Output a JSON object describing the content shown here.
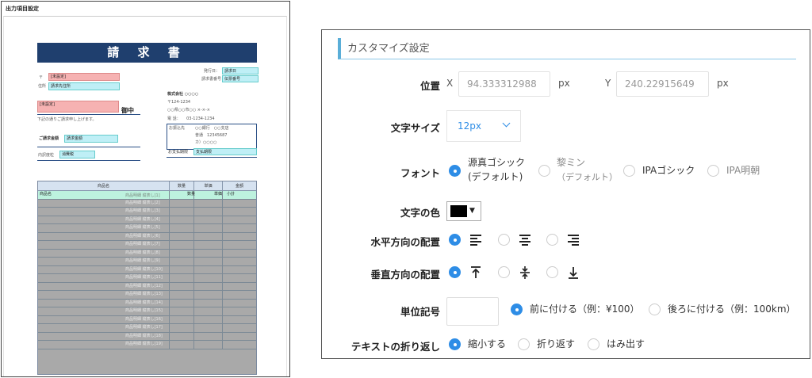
{
  "left_panel": {
    "title": "出力項目設定",
    "invoice_title": "請 求 書",
    "postal_mark": "〒",
    "postal_field": "[未設定]",
    "address_label": "住所",
    "address_field": "請求先住所",
    "recipient_field": "[未設定]",
    "honorific": "御中",
    "greeting": "下記の通りご請求申し上げます。",
    "amount_label": "ご請求金額",
    "amount_field": "請求金額",
    "content_label": "内訳度粒",
    "content_field": "消費税",
    "issue_date_label": "発行日：",
    "issue_date_field": "請求日",
    "invoice_no_label": "請求書番号：",
    "invoice_no_field": "伝票番号",
    "company_name": "株式会社 ○○○○",
    "company_zip": "〒124-1234",
    "company_addr": "○○県○○市○○ ×-×-×",
    "company_tel": "電 話：　　03-1234-1234",
    "bank_label": "お振込先",
    "bank_line1": "○○銀行　○○支店",
    "bank_line2": "普通　12345687",
    "bank_line3": "カ）○○○○",
    "due_label": "お支払期限",
    "due_field": "支払期限",
    "table_headers": [
      "商品名",
      "数量",
      "単価",
      "金額"
    ],
    "first_row": {
      "name_field": "商品名",
      "desc": "商品明細 縦表し[1]",
      "qty": "数量",
      "price": "単価",
      "sub": "小計"
    },
    "rows": [
      "商品明細 縦表し[2]",
      "商品明細 縦表し[3]",
      "商品明細 縦表し[4]",
      "商品明細 縦表し[5]",
      "商品明細 縦表し[6]",
      "商品明細 縦表し[7]",
      "商品明細 縦表し[8]",
      "商品明細 縦表し[9]",
      "商品明細 縦表し[10]",
      "商品明細 縦表し[11]",
      "商品明細 縦表し[12]",
      "商品明細 縦表し[13]",
      "商品明細 縦表し[14]",
      "商品明細 縦表し[15]",
      "商品明細 縦表し[16]",
      "商品明細 縦表し[17]",
      "商品明細 縦表し[18]",
      "商品明細 縦表し[19]"
    ]
  },
  "settings": {
    "header": "カスタマイズ設定",
    "position": {
      "label": "位置",
      "x_label": "X",
      "x_value": "94.333312988",
      "x_unit": "px",
      "y_label": "Y",
      "y_value": "240.22915649",
      "y_unit": "px"
    },
    "font_size": {
      "label": "文字サイズ",
      "value": "12px"
    },
    "font": {
      "label": "フォント",
      "options": [
        "源真ゴシック",
        "(デフォルト)",
        "黎ミン",
        "（デフォルト）",
        "IPAゴシック",
        "IPA明朝"
      ]
    },
    "text_color": {
      "label": "文字の色",
      "value": "#000000"
    },
    "horizontal_align": {
      "label": "水平方向の配置",
      "selected": "left"
    },
    "vertical_align": {
      "label": "垂直方向の配置",
      "selected": "top"
    },
    "unit_symbol": {
      "label": "単位記号",
      "value": "",
      "options": [
        "前に付ける（例：¥100）",
        "後ろに付ける（例：100km）"
      ]
    },
    "wrap": {
      "label": "テキストの折り返し",
      "options": [
        "縮小する",
        "折り返す",
        "はみ出す"
      ]
    },
    "accent_color": "#2e8de6",
    "header_bar_color": "#5aaed8"
  }
}
